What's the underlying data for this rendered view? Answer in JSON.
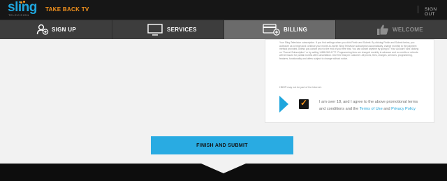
{
  "header": {
    "logo_text": "sling",
    "logo_tag": "TELEVISION",
    "tagline": "TAKE BACK TV",
    "signout_label": "SIGN OUT"
  },
  "steps": [
    {
      "label": "SIGN UP",
      "icon": "user-add-icon",
      "state": "done"
    },
    {
      "label": "SERVICES",
      "icon": "tv-icon",
      "state": "done"
    },
    {
      "label": "BILLING",
      "icon": "credit-card-icon",
      "state": "active"
    },
    {
      "label": "WELCOME",
      "icon": "thumbs-up-icon",
      "state": "upcoming"
    }
  ],
  "terms": {
    "body": "Your Sling Television subscription. If you find settings when you click Finish and Submit. By clicking Finish and Submit below, you authorize us to begin and continue your month-to-month Sling Television subscription automatically, charge monthly to the payment method provided, unless you cancel prior to the end of your free trial. You can cancel anytime by going to \"Your Account\" and clicking on \"Cancel Subscription\" or by calling 1-888-363-1777. Programming fees are charged monthly in advance and no credits or refunds will be issued for partial months after cancellation. One free trial per customer. All prices, fees, charges, services, programming, features, functionality and offers subject to change without notice.",
    "note": "HBO® may not be part of the Internet.",
    "agree_prefix": "I am over 18, and I agree to the above promotional terms and conditions and the ",
    "terms_link": "Terms of Use",
    "agree_and": " and ",
    "privacy_link": "Privacy Policy",
    "checked": true
  },
  "submit_label": "FINISH AND SUBMIT",
  "colors": {
    "accent_blue": "#29abe2",
    "accent_orange": "#f7941d",
    "topbar": "#161616"
  }
}
